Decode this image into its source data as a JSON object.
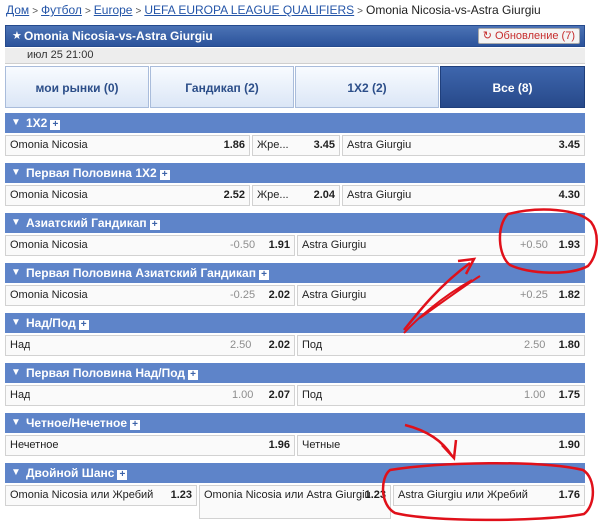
{
  "breadcrumb": {
    "items": [
      "Дом",
      "Футбол",
      "Europe",
      "UEFA EUROPA LEAGUE QUALIFIERS",
      "Omonia Nicosia-vs-Astra Giurgiu"
    ],
    "separator": ">"
  },
  "header": {
    "title": "Omonia Nicosia-vs-Astra Giurgiu",
    "refresh_label": "Обновление (7)"
  },
  "date": "июл 25 21:00",
  "tabs": [
    {
      "label": "мои рынки (0)"
    },
    {
      "label": "Гандикап (2)"
    },
    {
      "label": "1X2 (2)"
    },
    {
      "label": "Все (8)",
      "active": true
    }
  ],
  "markets": [
    {
      "title": "1X2",
      "cells": [
        {
          "name": "Omonia Nicosia",
          "odd": "1.86"
        },
        {
          "name": "Жре...",
          "odd": "3.45"
        },
        {
          "name": "Astra Giurgiu",
          "odd": "3.45"
        }
      ]
    },
    {
      "title": "Первая Половина 1X2",
      "cells": [
        {
          "name": "Omonia Nicosia",
          "odd": "2.52"
        },
        {
          "name": "Жре...",
          "odd": "2.04"
        },
        {
          "name": "Astra Giurgiu",
          "odd": "4.30"
        }
      ]
    },
    {
      "title": "Азиатский Гандикап",
      "cells": [
        {
          "name": "Omonia Nicosia",
          "hcap": "-0.50",
          "odd": "1.91"
        },
        {
          "name": "Astra Giurgiu",
          "hcap": "+0.50",
          "odd": "1.93"
        }
      ]
    },
    {
      "title": "Первая Половина Азиатский Гандикап",
      "cells": [
        {
          "name": "Omonia Nicosia",
          "hcap": "-0.25",
          "odd": "2.02"
        },
        {
          "name": "Astra Giurgiu",
          "hcap": "+0.25",
          "odd": "1.82"
        }
      ]
    },
    {
      "title": "Над/Под",
      "cells": [
        {
          "name": "Над",
          "hcap": "2.50",
          "odd": "2.02"
        },
        {
          "name": "Под",
          "hcap": "2.50",
          "odd": "1.80"
        }
      ]
    },
    {
      "title": "Первая Половина Над/Под",
      "cells": [
        {
          "name": "Над",
          "hcap": "1.00",
          "odd": "2.07"
        },
        {
          "name": "Под",
          "hcap": "1.00",
          "odd": "1.75"
        }
      ]
    },
    {
      "title": "Четное/Нечетное",
      "cells": [
        {
          "name": "Нечетное",
          "odd": "1.96"
        },
        {
          "name": "Четные",
          "odd": "1.90"
        }
      ]
    },
    {
      "title": "Двойной Шанс",
      "cells": [
        {
          "name": "Omonia Nicosia или Жребий",
          "odd": "1.23"
        },
        {
          "name": "Omonia Nicosia или Astra Giurgiu",
          "odd": "1.23"
        },
        {
          "name": "Astra Giurgiu или Жребий",
          "odd": "1.76"
        }
      ]
    }
  ],
  "colors": {
    "section_bar": "#5e84c9",
    "header_bar": "#2b539b",
    "annotation": "#e0101a",
    "link": "#2455a8"
  }
}
